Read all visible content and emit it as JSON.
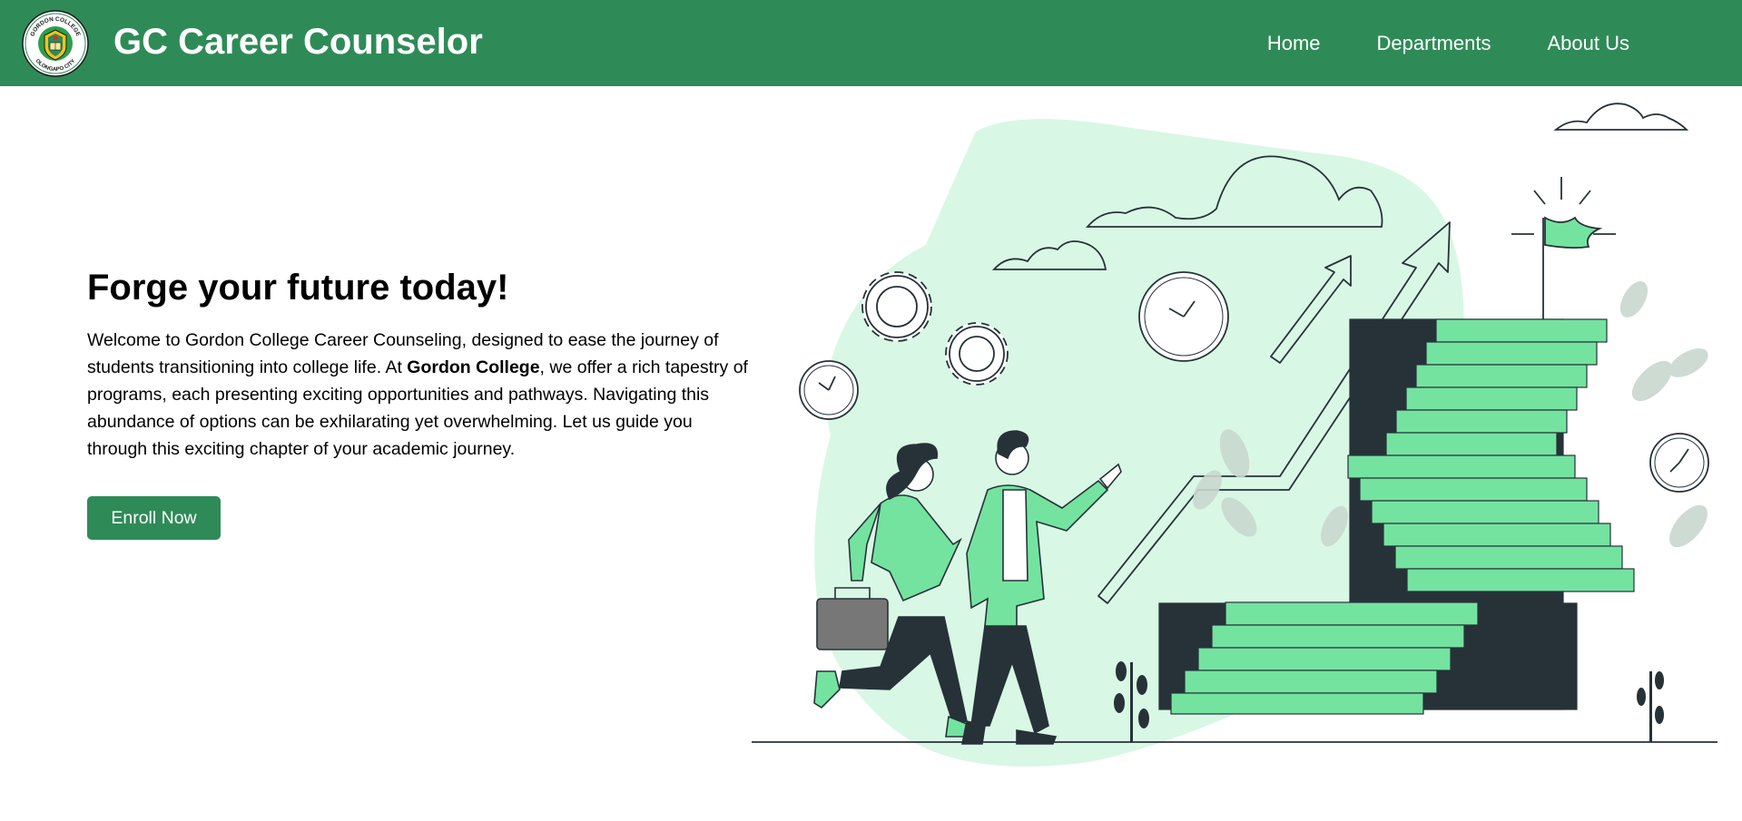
{
  "navbar": {
    "logo": {
      "text_top": "GORDON COLLEGE",
      "text_bottom": "OLONGAPO CITY"
    },
    "title": "GC Career Counselor",
    "links": [
      "Home",
      "Departments",
      "About Us"
    ]
  },
  "hero": {
    "heading": "Forge your future today!",
    "paragraph_before": "Welcome to Gordon College Career Counseling, designed to ease the journey of students transitioning into college life. At ",
    "paragraph_bold": "Gordon College",
    "paragraph_after": ", we offer a rich tapestry of programs, each presenting exciting opportunities and pathways. Navigating this abundance of options can be exhilarating yet overwhelming. Let us guide you through this exciting chapter of your academic journey.",
    "button_label": "Enroll Now"
  },
  "colors": {
    "brand_green": "#2e8b57",
    "stair_green": "#74e3a0",
    "blob_green": "#d9f7e5",
    "dark": "#263238"
  },
  "illustration": {
    "name": "career-growth-illustration",
    "elements": [
      "clouds",
      "gears",
      "clocks",
      "growth-arrows",
      "staircase",
      "flag",
      "plants",
      "woman-with-briefcase",
      "man-pointing"
    ]
  }
}
